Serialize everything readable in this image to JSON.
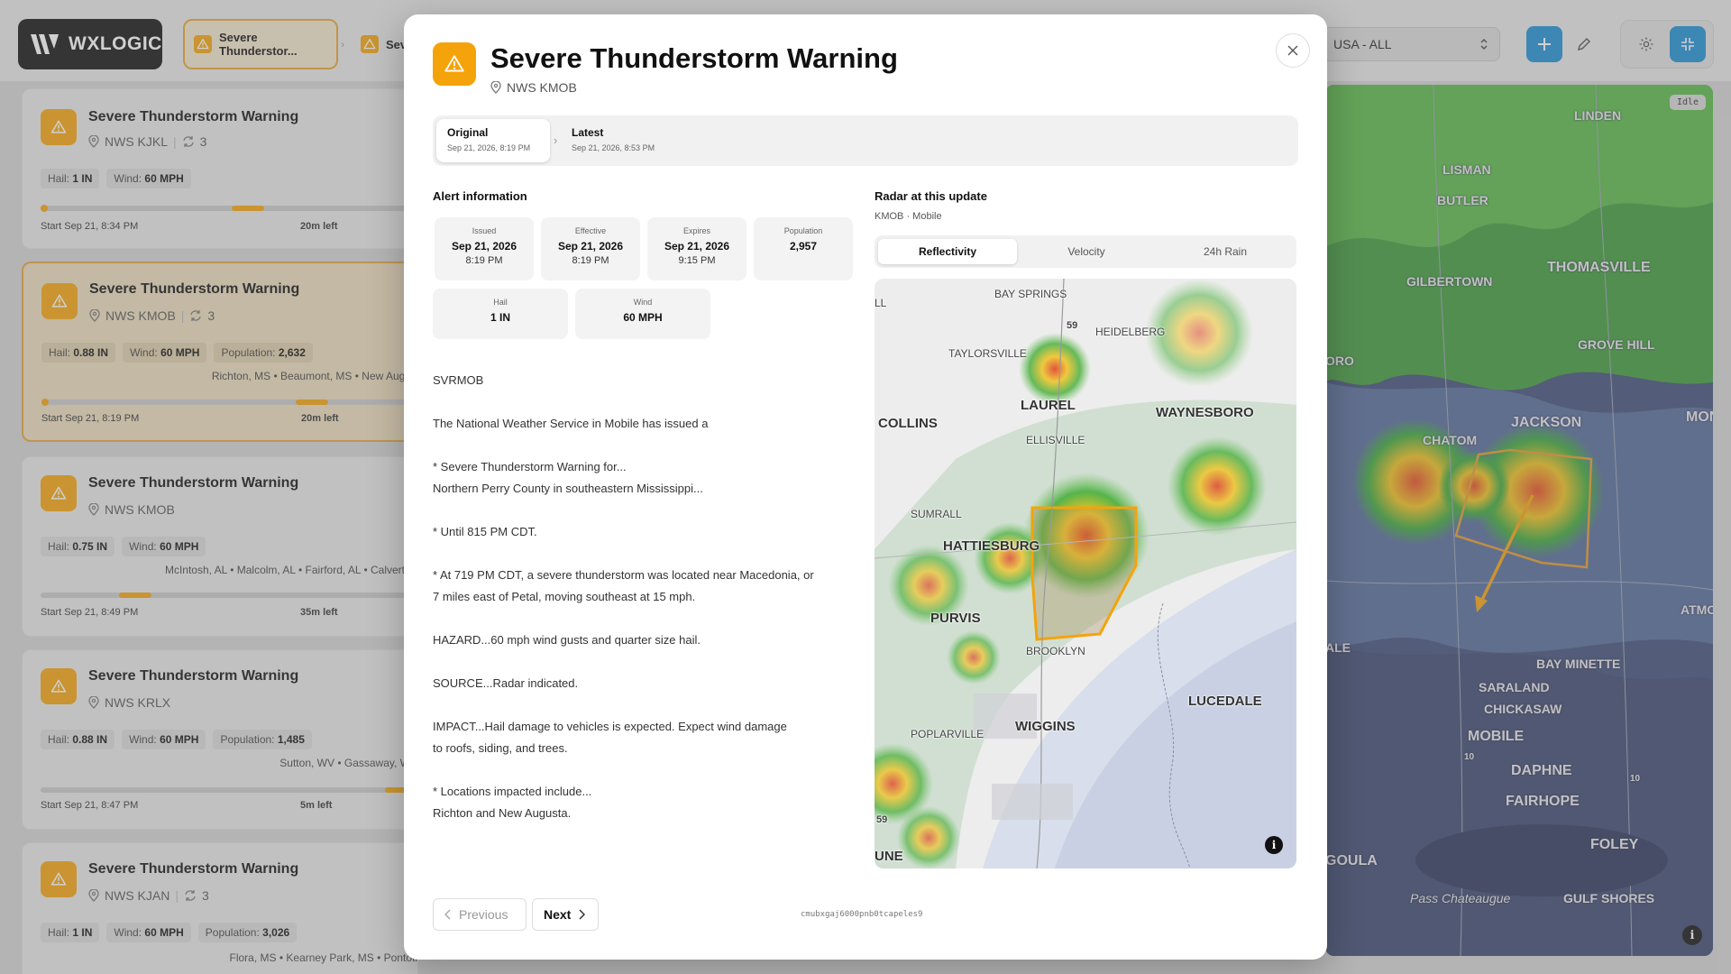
{
  "app": {
    "logo_text": "WXLOGIC",
    "breadcrumbs": [
      {
        "label": "Severe Thunderstor..."
      },
      {
        "label": "Sev"
      }
    ],
    "region_select": "USA - ALL",
    "map_status": "Idle"
  },
  "sidebar": {
    "cards": [
      {
        "title": "Severe Thunderstorm Warning",
        "office": "NWS KJKL",
        "updates": "3",
        "hail": "1 IN",
        "wind": "60 MPH",
        "population": "",
        "places": "",
        "start": "Start Sep 21, 8:34 PM",
        "left": "20m left",
        "progress": 0.55
      },
      {
        "title": "Severe Thunderstorm Warning",
        "office": "NWS KMOB",
        "updates": "3",
        "hail": "0.88 IN",
        "wind": "60 MPH",
        "population": "2,632",
        "places": "Richton, MS • Beaumont, MS • New Augus",
        "start": "Start Sep 21, 8:19 PM",
        "left": "20m left",
        "progress": 0.72
      },
      {
        "title": "Severe Thunderstorm Warning",
        "office": "NWS KMOB",
        "updates": "",
        "hail": "0.75 IN",
        "wind": "60 MPH",
        "population": "",
        "places": "McIntosh, AL • Malcolm, AL • Fairford, AL • Calvert, A",
        "start": "Start Sep 21, 8:49 PM",
        "left": "35m left",
        "progress": 0.25
      },
      {
        "title": "Severe Thunderstorm Warning",
        "office": "NWS KRLX",
        "updates": "",
        "hail": "0.88 IN",
        "wind": "60 MPH",
        "population": "1,485",
        "places": "Sutton, WV • Gassaway, WV",
        "start": "Start Sep 21, 8:47 PM",
        "left": "5m left",
        "progress": 0.97
      },
      {
        "title": "Severe Thunderstorm Warning",
        "office": "NWS KJAN",
        "updates": "3",
        "hail": "1 IN",
        "wind": "60 MPH",
        "population": "3,026",
        "places": "Flora, MS • Kearney Park, MS • Pontoti",
        "start": "",
        "left": "",
        "progress": 0
      }
    ],
    "labels": {
      "hail": "Hail:",
      "wind": "Wind:",
      "population": "Population:"
    }
  },
  "bg_map_labels": [
    "LINDEN",
    "LISMAN",
    "BUTLER",
    "GILBERTOWN",
    "THOMASVILLE",
    "GROVE HILL",
    "JACKSON",
    "CHATOM",
    "MON",
    "ATMO",
    "ALE",
    "BAY MINETTE",
    "SARALAND",
    "CHICKASAW",
    "MOBILE",
    "DAPHNE",
    "FAIRHOPE",
    "FOLEY",
    "GOULA",
    "Pass Chateaugue",
    "GULF SHORES",
    "ORO",
    "10",
    "10"
  ],
  "modal": {
    "title": "Severe Thunderstorm Warning",
    "office": "NWS KMOB",
    "timeline": {
      "original_label": "Original",
      "original_date": "Sep 21, 2026, 8:19 PM",
      "latest_label": "Latest",
      "latest_date": "Sep 21, 2026, 8:53 PM"
    },
    "alert_info": {
      "heading": "Alert information",
      "issued_label": "Issued",
      "issued_date": "Sep 21, 2026",
      "issued_time": "8:19 PM",
      "effective_label": "Effective",
      "effective_date": "Sep 21, 2026",
      "effective_time": "8:19 PM",
      "expires_label": "Expires",
      "expires_date": "Sep 21, 2026",
      "expires_time": "9:15 PM",
      "population_label": "Population",
      "population": "2,957",
      "hail_label": "Hail",
      "hail": "1 IN",
      "wind_label": "Wind",
      "wind": "60 MPH"
    },
    "text_lines": [
      "SVRMOB",
      "",
      "The National Weather Service in Mobile has issued a",
      "",
      "* Severe Thunderstorm Warning for...",
      "Northern Perry County in southeastern Mississippi...",
      "",
      "* Until 815 PM CDT.",
      "",
      "* At 719 PM CDT, a severe thunderstorm was located near Macedonia, or",
      "7 miles east of Petal, moving southeast at 15 mph.",
      "",
      "HAZARD...60 mph wind gusts and quarter size hail.",
      "",
      "SOURCE...Radar indicated.",
      "",
      "IMPACT...Hail damage to vehicles is expected. Expect wind damage",
      "to roofs, siding, and trees.",
      "",
      "* Locations impacted include...",
      "Richton and New Augusta."
    ],
    "radar": {
      "heading": "Radar at this update",
      "station": "KMOB · Mobile",
      "tabs": [
        "Reflectivity",
        "Velocity",
        "24h Rain"
      ],
      "labels": [
        "BAY SPRINGS",
        "59",
        "HEIDELBERG",
        "TAYLORSVILLE",
        "LAUREL",
        "WAYNESBORO",
        "COLLINS",
        "ELLISVILLE",
        "SUMRALL",
        "HATTIESBURG",
        "PURVIS",
        "BROOKLYN",
        "LUCEDALE",
        "POPLARVILLE",
        "WIGGINS",
        "59",
        "UNE",
        "LL"
      ]
    },
    "pager": {
      "previous": "Previous",
      "next": "Next"
    },
    "alert_id": "cmubxgaj6000pnb0tcapeles9"
  },
  "colors": {
    "accent": "#f5a30b",
    "primary": "#1e8fd6"
  }
}
